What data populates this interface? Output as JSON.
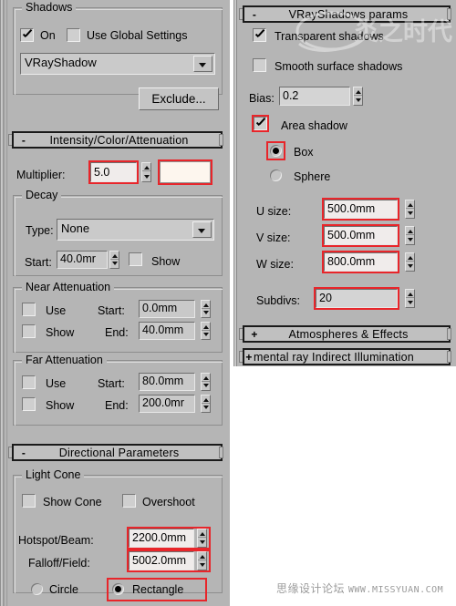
{
  "window": {
    "app": "3ds Max Modify Panel",
    "watermark_top": "炎之时代",
    "watermark_bottom_cn": "思缘设计论坛",
    "watermark_bottom_en": "WWW.MISSYUAN.COM"
  },
  "colors": {
    "panel_bg": "#b5b5b5",
    "highlight_red": "#e8252a",
    "field_bg": "#c9c9c9",
    "header_bg": "#c0c0c0",
    "swatch": "#fdf6ee"
  },
  "left_panel": {
    "shadows_group": {
      "label": "Shadows",
      "on_checkbox": {
        "label": "On",
        "checked": true
      },
      "use_global_checkbox": {
        "label": "Use Global Settings",
        "checked": false
      },
      "shadow_type": {
        "value": "VRayShadow",
        "icon": "chevron-down-icon"
      }
    },
    "exclude_button": {
      "label": "Exclude..."
    },
    "intensity_rollout": {
      "sign": "-",
      "title": "Intensity/Color/Attenuation",
      "multiplier": {
        "label": "Multiplier:",
        "value": "5.0",
        "highlighted": true
      },
      "color_swatch": {
        "name": "light-color-swatch",
        "highlighted": true
      },
      "decay": {
        "label": "Decay",
        "type_label": "Type:",
        "type_value": "None",
        "start_label": "Start:",
        "start_value": "40.0mr",
        "show_checkbox": {
          "label": "Show",
          "checked": false
        }
      },
      "near_attenuation": {
        "label": "Near Attenuation",
        "use_checkbox": {
          "label": "Use",
          "checked": false
        },
        "show_checkbox": {
          "label": "Show",
          "checked": false
        },
        "start_label": "Start:",
        "start_value": "0.0mm",
        "end_label": "End:",
        "end_value": "40.0mm"
      },
      "far_attenuation": {
        "label": "Far Attenuation",
        "use_checkbox": {
          "label": "Use",
          "checked": false
        },
        "show_checkbox": {
          "label": "Show",
          "checked": false
        },
        "start_label": "Start:",
        "start_value": "80.0mm",
        "end_label": "End:",
        "end_value": "200.0mr"
      }
    },
    "directional_rollout": {
      "sign": "-",
      "title": "Directional Parameters",
      "light_cone": {
        "label": "Light Cone",
        "show_cone_checkbox": {
          "label": "Show Cone",
          "checked": false
        },
        "overshoot_checkbox": {
          "label": "Overshoot",
          "checked": false
        },
        "hotspot_label": "Hotspot/Beam:",
        "hotspot_value": "2200.0mm",
        "hotspot_highlighted": true,
        "falloff_label": "Falloff/Field:",
        "falloff_value": "5002.0mm",
        "falloff_highlighted": true,
        "circle_radio": {
          "label": "Circle",
          "selected": false
        },
        "rectangle_radio": {
          "label": "Rectangle",
          "selected": true,
          "highlighted": true
        }
      }
    }
  },
  "right_panel": {
    "vrayshadows_rollout": {
      "sign": "-",
      "title": "VRayShadows params",
      "transparent_shadows": {
        "label": "Transparent shadows",
        "checked": true
      },
      "smooth_surface_shadows": {
        "label": "Smooth surface shadows",
        "checked": false
      },
      "bias": {
        "label": "Bias:",
        "value": "0.2"
      },
      "area_shadow": {
        "label": "Area shadow",
        "checked": true,
        "highlighted": true
      },
      "box_radio": {
        "label": "Box",
        "selected": true,
        "highlighted": true
      },
      "sphere_radio": {
        "label": "Sphere",
        "selected": false
      },
      "u_size": {
        "label": "U size:",
        "value": "500.0mm",
        "highlighted": true
      },
      "v_size": {
        "label": "V size:",
        "value": "500.0mm",
        "highlighted": true
      },
      "w_size": {
        "label": "W size:",
        "value": "800.0mm",
        "highlighted": true
      },
      "subdivs": {
        "label": "Subdivs:",
        "value": "20",
        "highlighted": true
      }
    },
    "atmospheres_rollout": {
      "sign": "+",
      "title": "Atmospheres & Effects"
    },
    "mental_ray_rollout": {
      "sign": "+",
      "title": "mental ray Indirect Illumination"
    }
  }
}
